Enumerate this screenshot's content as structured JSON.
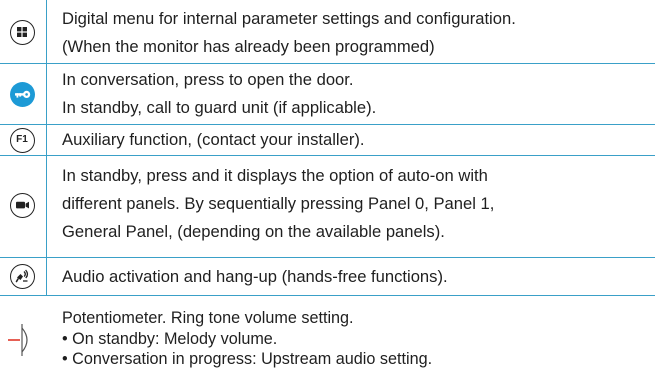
{
  "rows": [
    {
      "icon": "menu-grid-icon",
      "lines": [
        "Digital menu for internal parameter settings and configuration.",
        "(When the monitor has already been programmed)"
      ]
    },
    {
      "icon": "key-icon",
      "lines": [
        "In conversation, press to open the door.",
        "In standby, call to guard unit (if applicable)."
      ]
    },
    {
      "icon": "f1-button-icon",
      "icon_label": "F1",
      "lines": [
        "Auxiliary function, (contact your installer)."
      ]
    },
    {
      "icon": "camera-icon",
      "lines": [
        "In standby, press and it displays the option of auto-on with",
        "different panels. By sequentially pressing Panel 0, Panel 1,",
        "General Panel, (depending on the available panels)."
      ]
    },
    {
      "icon": "handsfree-audio-icon",
      "lines": [
        "Audio activation and hang-up (hands-free functions)."
      ]
    },
    {
      "icon": "potentiometer-icon",
      "lines": [
        "Potentiometer. Ring tone volume setting.",
        "• On standby: Melody volume.",
        "• Conversation in progress: Upstream audio setting."
      ]
    }
  ],
  "colors": {
    "rule": "#3aa0c8",
    "key_button": "#1d9ad6",
    "text": "#1f1f1f"
  }
}
